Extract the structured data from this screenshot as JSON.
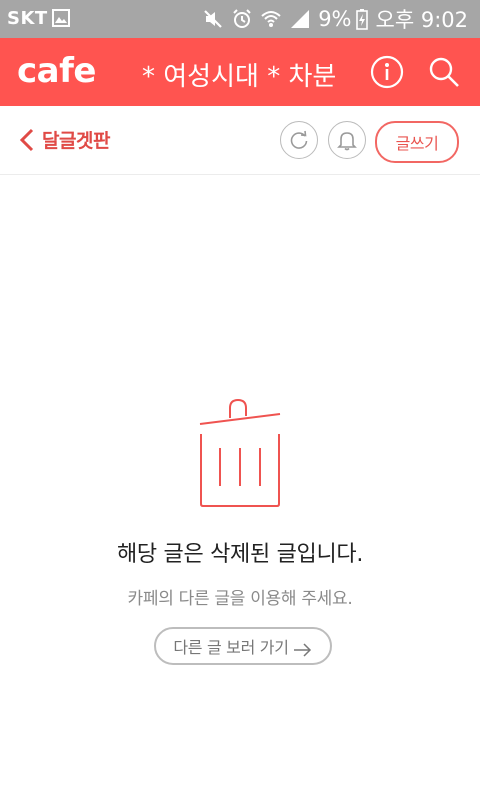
{
  "status_bar": {
    "carrier": "SKT",
    "battery_percent": "9%",
    "time": "오후 9:02",
    "icons": [
      "gallery-icon",
      "mute-icon",
      "alarm-icon",
      "wifi-icon",
      "signal-icon",
      "battery-charging-icon"
    ]
  },
  "app_bar": {
    "logo": "cafe",
    "cafe_title": "* 여성시대 * 차분",
    "info_icon": "info-icon",
    "search_icon": "search-icon",
    "background_color": "#ff5450"
  },
  "sub_bar": {
    "board_name": "달글겟판",
    "write_label": "글쓰기",
    "icons": [
      "back-chevron-icon",
      "refresh-icon",
      "bell-icon"
    ]
  },
  "empty_state": {
    "icon": "trash-icon",
    "title": "해당 글은 삭제된 글입니다.",
    "subtitle": "카페의 다른 글을 이용해 주세요.",
    "button_label": "다른 글 보러 가기"
  },
  "colors": {
    "accent": "#ff5450",
    "status_bar": "#a6a6a6"
  }
}
